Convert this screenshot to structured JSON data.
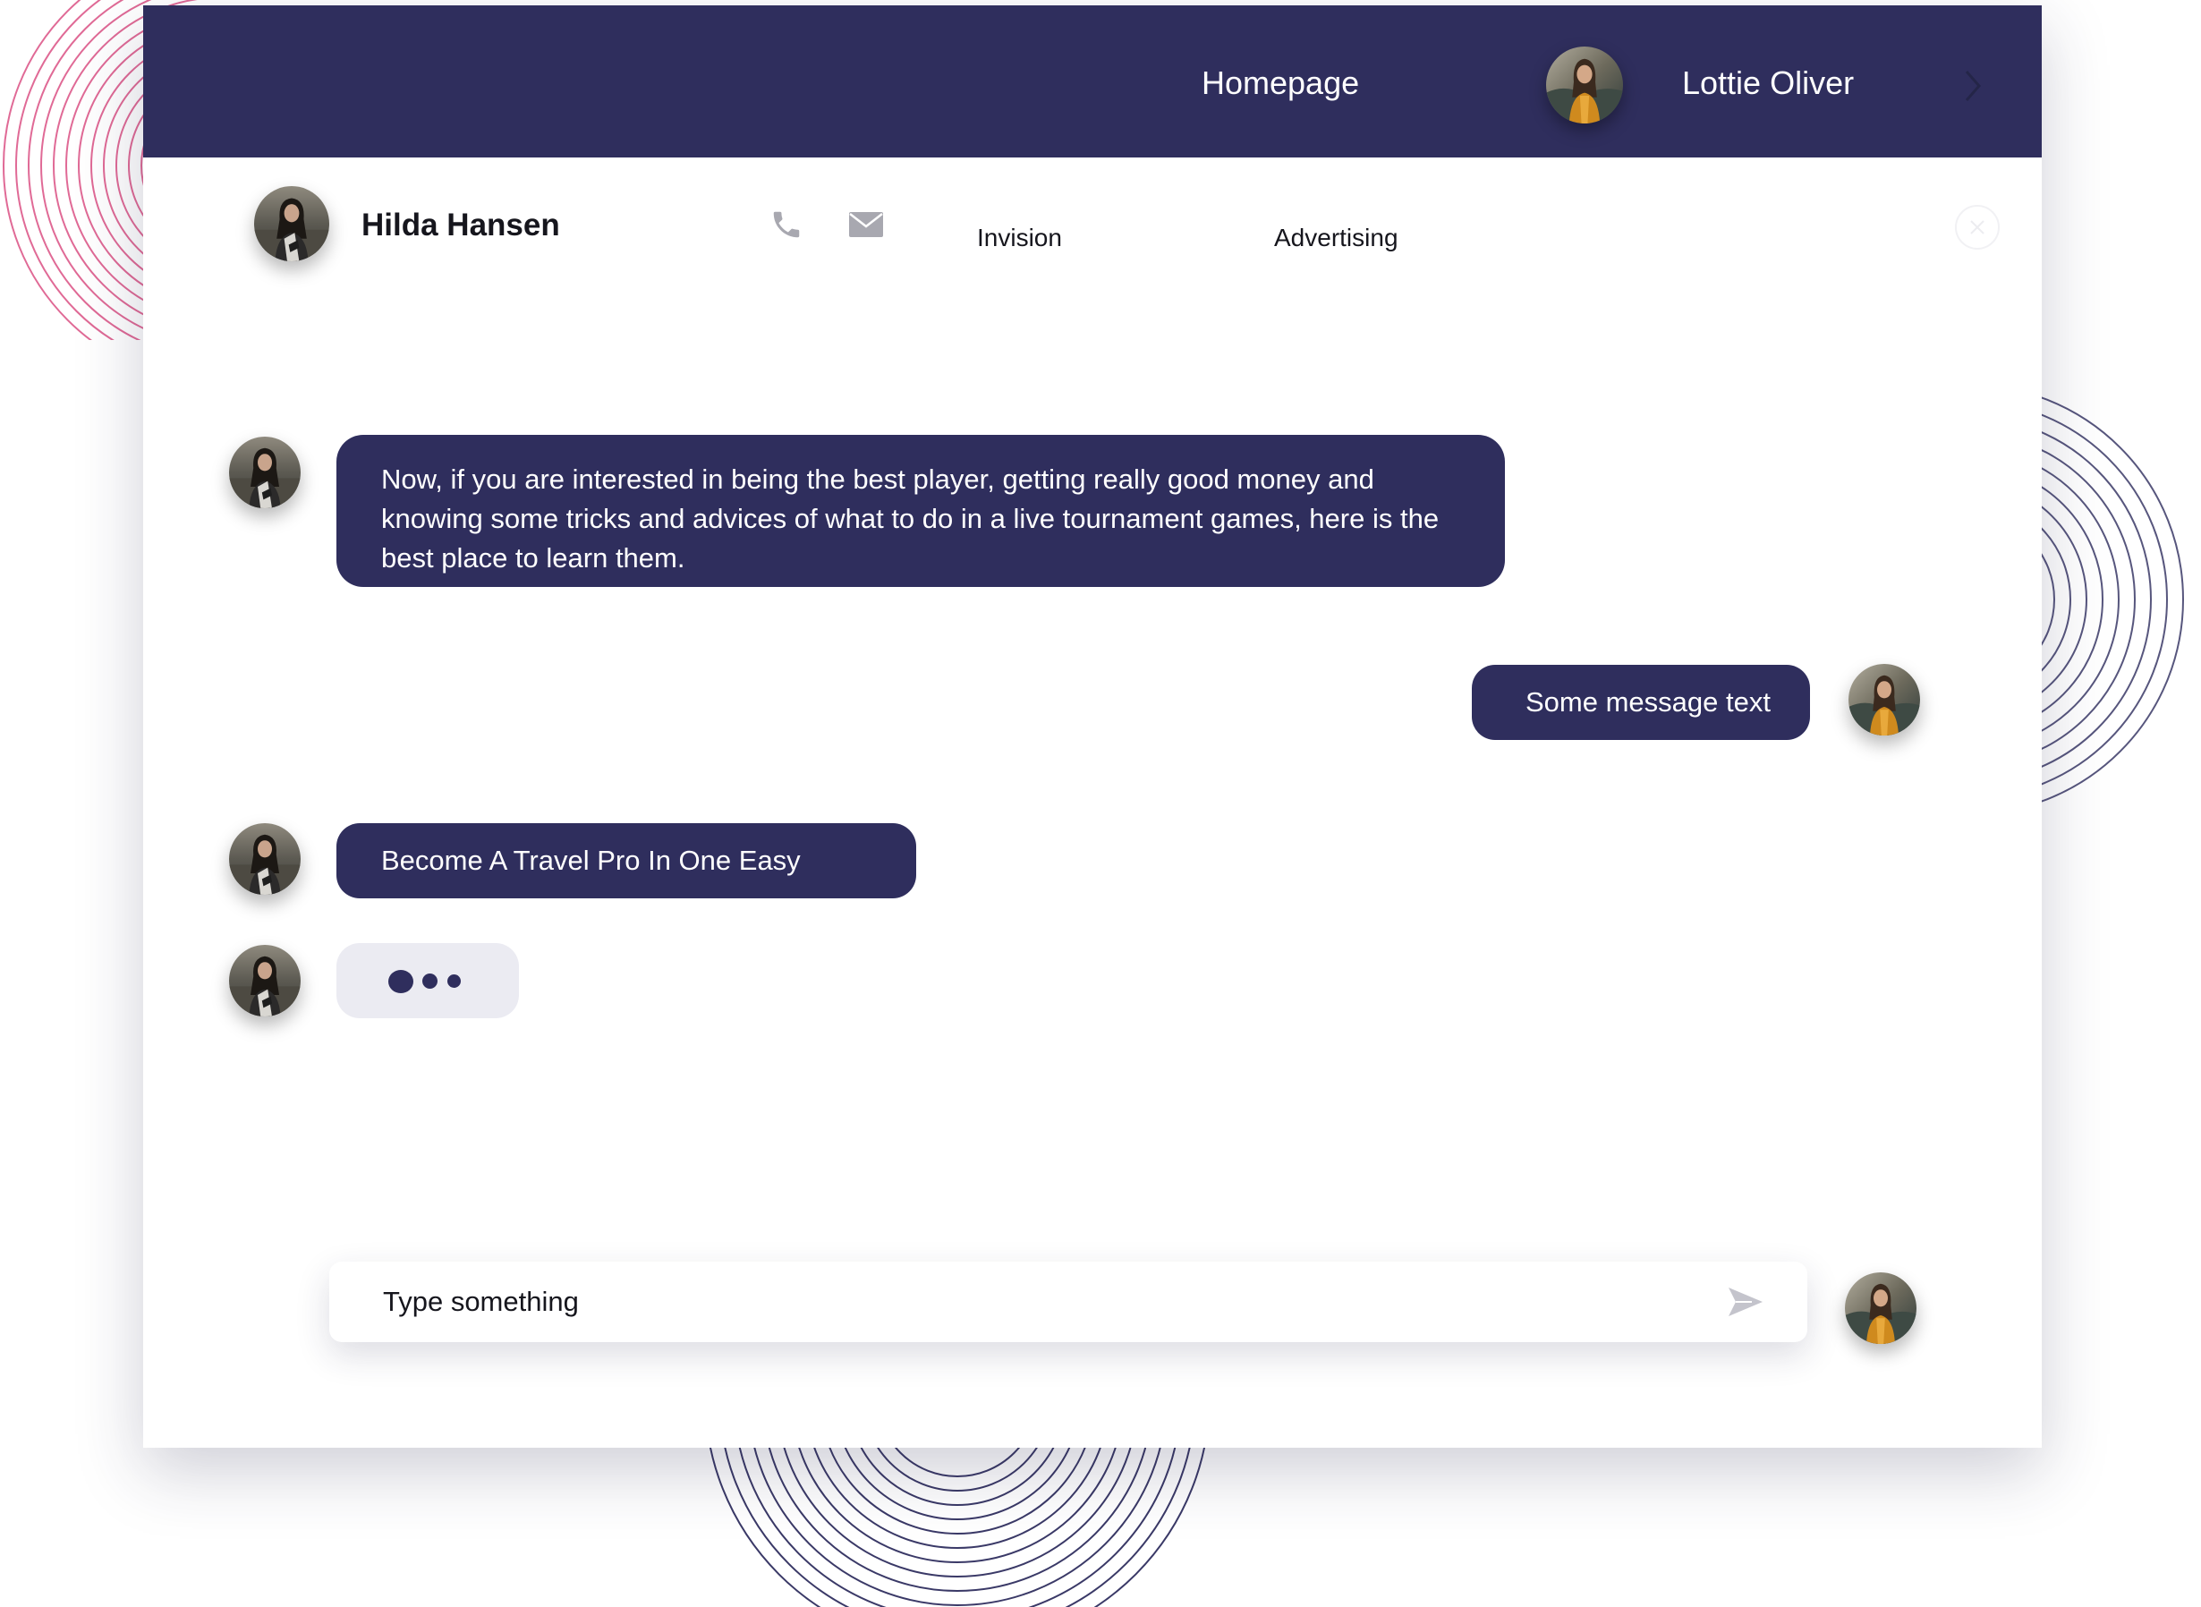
{
  "topbar": {
    "nav_link": "Homepage",
    "user_name": "Lottie Oliver",
    "background": "#2f2e5d"
  },
  "contact": {
    "name": "Hilda Hansen",
    "tags": [
      "Invision",
      "Advertising"
    ]
  },
  "messages": [
    {
      "sender": "Hilda Hansen",
      "side": "left",
      "text": "Now, if you are interested in being the best player, getting really good money and knowing some tricks and advices of what to do in a live tournament games, here is the best place to learn them."
    },
    {
      "sender": "Lottie Oliver",
      "side": "right",
      "text": "Some message text"
    },
    {
      "sender": "Hilda Hansen",
      "side": "left",
      "text": "Become A Travel Pro In One Easy"
    },
    {
      "sender": "Hilda Hansen",
      "side": "left",
      "typing": true
    }
  ],
  "composer": {
    "placeholder": "Type something"
  },
  "icons": {
    "phone": "phone-icon",
    "mail": "mail-icon",
    "close": "close-icon",
    "chevron": "chevron-right-icon",
    "send": "send-icon"
  },
  "colors": {
    "accent": "#2f2e5d",
    "typing_bubble": "#ebebf2",
    "deco_pink": "#e06a96",
    "deco_navy": "#3a3967"
  }
}
